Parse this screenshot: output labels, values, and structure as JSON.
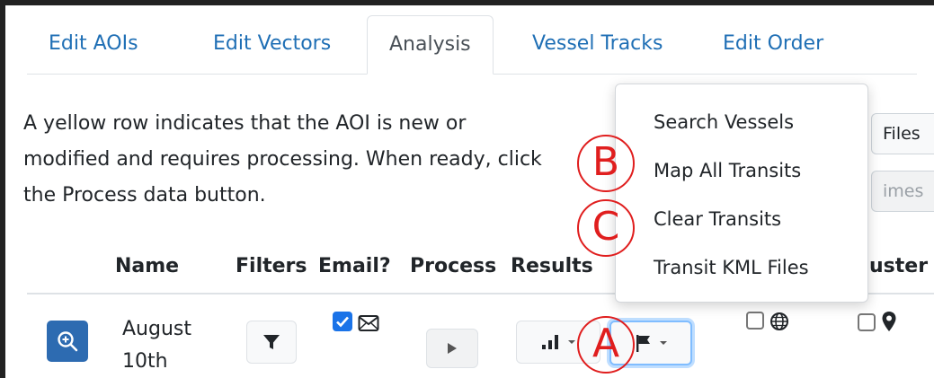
{
  "tabs": [
    {
      "label": "Edit AOIs",
      "active": false
    },
    {
      "label": "Edit Vectors",
      "active": false
    },
    {
      "label": "Analysis",
      "active": true
    },
    {
      "label": "Vessel Tracks",
      "active": false
    },
    {
      "label": "Edit Order",
      "active": false
    }
  ],
  "info": {
    "line1": "A yellow row indicates that the AOI is new or",
    "line2": "modified and requires processing. When ready, click",
    "line3": "the Process data button."
  },
  "side_buttons": {
    "files": "Files",
    "times": "imes"
  },
  "table": {
    "headers": {
      "name": "Name",
      "filters": "Filters",
      "email": "Email?",
      "process": "Process",
      "results": "Results",
      "cluster": "uster"
    },
    "row": {
      "name_line1": "August",
      "name_line2": "10th",
      "email_checked": true,
      "globe_checked": false,
      "pin_checked": false
    }
  },
  "dropdown": {
    "items": [
      "Search Vessels",
      "Map All Transits",
      "Clear Transits",
      "Transit KML Files"
    ]
  },
  "markers": {
    "a": "A",
    "b": "B",
    "c": "C"
  },
  "colors": {
    "link": "#1f6fb5",
    "primary": "#2d6bb1",
    "marker": "#e01e1e",
    "checkbox": "#1a73e8"
  }
}
